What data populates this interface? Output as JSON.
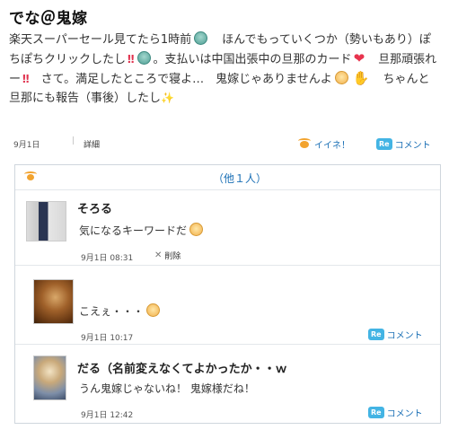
{
  "post": {
    "title": "でな＠鬼嫁",
    "body": {
      "t1": "楽天スーパーセール見てたら1時前",
      "t2": "ほんでもっていくつか（勢いもあり）ぽちぽちクリックしたし",
      "t3": "。支払いは中国出張中の旦那のカード",
      "t4": "旦那頑張れー",
      "t5": "さて。満足したところで寝よ…　鬼嫁じゃありませんよ",
      "t6": "ちゃんと旦那にも報告（事後）したし",
      "emoji_bangbang": "‼",
      "emoji_heart": "❤",
      "emoji_hand": "✋",
      "emoji_sparkles": "✨"
    },
    "date": "9月1日",
    "separator": "|",
    "detail_label": "詳細",
    "like_label": "イイネ！",
    "re_badge": "Re",
    "comment_label": "コメント"
  },
  "thread": {
    "more_label": "（他１人）",
    "comments": [
      {
        "name": "そろる",
        "text": "気になるキーワードだ",
        "time": "9月1日 08:31",
        "delete_label": "削除",
        "delete_icon": "✕"
      },
      {
        "name": "",
        "text": "こえぇ・・・",
        "time": "9月1日 10:17",
        "re_badge": "Re",
        "comment_label": "コメント"
      },
      {
        "name": "だる（名前変えなくてよかったか・・ｗ",
        "text": "うん鬼嫁じゃないね！ 鬼嫁様だね！",
        "time": "9月1日 12:42",
        "re_badge": "Re",
        "comment_label": "コメント"
      }
    ]
  },
  "colors": {
    "link": "#1a6fb5",
    "re_badge": "#43b4e4",
    "like_icon": "#f2a32e",
    "border": "#cfd6dd"
  },
  "icons": [
    "face-emoji-icon",
    "bell-emoji-icon",
    "bangbang-emoji-icon",
    "heart-emoji-icon",
    "hand-emoji-icon",
    "sparkles-emoji-icon",
    "like-icon",
    "re-comment-icon",
    "delete-x-icon",
    "thread-like-icon"
  ]
}
